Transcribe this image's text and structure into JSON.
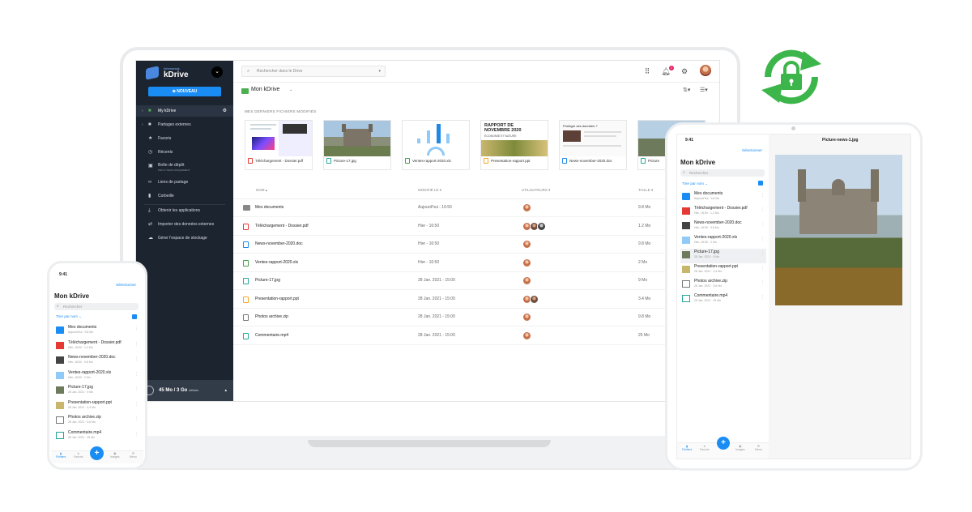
{
  "laptop": {
    "sidebar": {
      "brand_tag": "Infomaniak",
      "brand_name": "kDrive",
      "new_button": "NOUVEAU",
      "items": [
        {
          "label": "My kDrive",
          "icon": "folder-icon"
        },
        {
          "label": "Partages externes",
          "icon": "folder-share-icon"
        },
        {
          "label": "Favoris",
          "icon": "star-icon"
        },
        {
          "label": "Récents",
          "icon": "clock-icon"
        },
        {
          "label": "Boîte de dépôt",
          "sub": "PRO & TEAM UNIQUEMENT",
          "icon": "dropbox-icon"
        },
        {
          "label": "Liens de partage",
          "icon": "link-icon"
        },
        {
          "label": "Corbeille",
          "icon": "trash-icon"
        },
        {
          "label": "Obtenir les applications",
          "icon": "download-icon"
        },
        {
          "label": "Importer des données externes",
          "icon": "import-icon"
        },
        {
          "label": "Gérer l'espace de stockage",
          "icon": "storage-icon"
        }
      ],
      "storage_used": "45 Mo / 3 Go",
      "storage_suffix": "utilisés"
    },
    "topbar": {
      "search_placeholder": "Rechercher dans le Drive",
      "notif_count": "1"
    },
    "breadcrumb": "Mon kDrive",
    "recent_title": "MES DERNIERS FICHIERS MODIFIÉS",
    "recent_cards": [
      {
        "name": "Téléchargement - Dossier.pdf",
        "color": "#e53935"
      },
      {
        "name": "Picture-17.jpg",
        "color": "#26a69a"
      },
      {
        "name": "Ventes-rapport-2020.xls",
        "color": "#43a047"
      },
      {
        "name": "Presentation-rapport.ppt",
        "color": "#f9a825"
      },
      {
        "name": "News-november-2020.doc",
        "color": "#1e88e5"
      },
      {
        "name": "Picture",
        "color": "#26a69a"
      }
    ],
    "card_text": {
      "rapport_title": "RAPPORT DE NOVEMBRE 2020",
      "rapport_sub": "ÉCONOMIE ET NATURE",
      "news_title": "Protéger ses données ?"
    },
    "table": {
      "headers": {
        "name": "NOM",
        "modified": "MODIFIÉ LE",
        "users": "UTILISATEURS",
        "size": "TAILLE"
      },
      "rows": [
        {
          "name": "Mes documents",
          "date": "Aujourd'hui - 16:50",
          "size": "9.8 Mo",
          "icon": "folder-icon",
          "color": "#888888",
          "users": 1
        },
        {
          "name": "Téléchargement - Dossier.pdf",
          "date": "Hier - 16:50",
          "size": "1.2 Mo",
          "icon": "pdf-icon",
          "color": "#e53935",
          "users": 3
        },
        {
          "name": "News-november-2020.doc",
          "date": "Hier - 16:50",
          "size": "9.8 Mo",
          "icon": "doc-icon",
          "color": "#1e88e5",
          "users": 1
        },
        {
          "name": "Ventes-rapport-2020.xls",
          "date": "Hier - 16:50",
          "size": "2 Mo",
          "icon": "xls-icon",
          "color": "#43a047",
          "users": 1
        },
        {
          "name": "Picture-17.jpg",
          "date": "28 Jan. 2021 - 15:00",
          "size": "9 Mo",
          "icon": "image-icon",
          "color": "#26a69a",
          "users": 1
        },
        {
          "name": "Presentation-rapport.ppt",
          "date": "28 Jan. 2021 - 15:00",
          "size": "3.4 Mo",
          "icon": "ppt-icon",
          "color": "#f9a825",
          "users": 2
        },
        {
          "name": "Photos archive.zip",
          "date": "28 Jan. 2021 - 15:00",
          "size": "9.8 Mo",
          "icon": "zip-icon",
          "color": "#757575",
          "users": 1
        },
        {
          "name": "Commentaire.mp4",
          "date": "28 Jan. 2021 - 15:00",
          "size": "25 Mo",
          "icon": "video-icon",
          "color": "#26a69a",
          "users": 1
        }
      ]
    }
  },
  "tablet": {
    "time": "9:41",
    "viewer_title": "Picture-news-1.jpg",
    "select_label": "Sélectionner",
    "title": "Mon kDrive",
    "search_placeholder": "Rechercher",
    "sort_label": "Trier par nom",
    "items": [
      {
        "name": "Mes documents",
        "meta": "Aujourd'hui · 9,8 Mo"
      },
      {
        "name": "Téléchargement - Dossier.pdf",
        "meta": "Hier, 16:50 · 1,2 Mo"
      },
      {
        "name": "News-november-2020.doc",
        "meta": "Hier, 16:50 · 9,8 Mo"
      },
      {
        "name": "Ventes-rapport-2020.xls",
        "meta": "Hier, 16:50 · 2 Mo"
      },
      {
        "name": "Picture-17.jpg",
        "meta": "28 Jan. 2021 · 9 Mo"
      },
      {
        "name": "Presentation-rapport.ppt",
        "meta": "28 Jan. 2021 · 3,4 Mo"
      },
      {
        "name": "Photos archive.zip",
        "meta": "28 Jan. 2021 · 9,8 Mo"
      },
      {
        "name": "Commentaire.mp4",
        "meta": "28 Jan. 2021 · 25 Mo"
      }
    ],
    "tabs": [
      "Fichiers",
      "Favoris",
      "",
      "Images",
      "Menu"
    ]
  },
  "phone": {
    "time": "9:41",
    "select_label": "Sélectionner",
    "title": "Mon kDrive",
    "search_placeholder": "Rechercher",
    "sort_label": "Trier par nom",
    "items": [
      {
        "name": "Mes documents",
        "meta": "Aujourd'hui · 9,8 Mo"
      },
      {
        "name": "Téléchargement - Dossier.pdf",
        "meta": "Hier, 16:50 · 1,2 Mo"
      },
      {
        "name": "News-november-2020.doc",
        "meta": "Hier, 16:50 · 9,8 Mo"
      },
      {
        "name": "Ventes-rapport-2020.xls",
        "meta": "Hier, 16:50 · 2 Mo"
      },
      {
        "name": "Picture-17.jpg",
        "meta": "28 Jan. 2021 · 9 Mo"
      },
      {
        "name": "Presentation-rapport.ppt",
        "meta": "28 Jan. 2021 · 3,4 Mo"
      },
      {
        "name": "Photos archive.zip",
        "meta": "28 Jan. 2021 · 9,8 Mo"
      },
      {
        "name": "Commentaire.mp4",
        "meta": "28 Jan. 2021 · 25 Mo"
      }
    ],
    "tabs": [
      "Fichiers",
      "Favoris",
      "",
      "Images",
      "Menu"
    ]
  },
  "accent": "#1a8df5",
  "sync_color": "#3cb54a"
}
